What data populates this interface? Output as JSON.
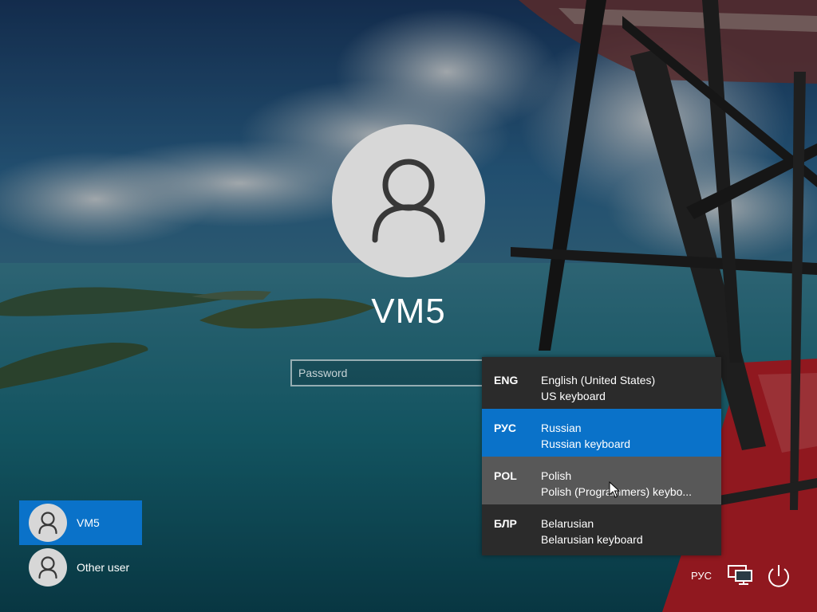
{
  "login": {
    "username": "VM5",
    "password_placeholder": "Password"
  },
  "language_menu": {
    "items": [
      {
        "code": "ENG",
        "name": "English (United States)",
        "keyboard": "US keyboard",
        "state": "normal"
      },
      {
        "code": "РУС",
        "name": "Russian",
        "keyboard": "Russian keyboard",
        "state": "selected"
      },
      {
        "code": "POL",
        "name": "Polish",
        "keyboard": "Polish (Programmers) keybo...",
        "state": "hover"
      },
      {
        "code": "БЛР",
        "name": "Belarusian",
        "keyboard": "Belarusian keyboard",
        "state": "normal"
      }
    ]
  },
  "users": [
    {
      "name": "VM5",
      "active": true
    },
    {
      "name": "Other user",
      "active": false
    }
  ],
  "system_tray": {
    "language_indicator": "РУС",
    "icons": [
      "network-icon",
      "power-icon"
    ]
  },
  "colors": {
    "accent": "#0a72c9",
    "menu_bg": "#2b2b2b",
    "menu_hover": "#585858",
    "avatar_bg": "#d7d7d7"
  }
}
